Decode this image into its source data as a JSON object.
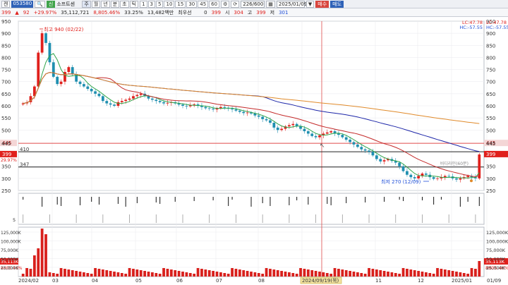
{
  "toolbar": {
    "menu_label": "켄",
    "code": "053580",
    "theme_tag": "신",
    "stock_name": "소프트센",
    "periods": [
      "주",
      "월",
      "년",
      "분",
      "초",
      "틱"
    ],
    "intervals": [
      "1",
      "3",
      "5",
      "10",
      "15",
      "30",
      "45",
      "60"
    ],
    "page_count": "226/600",
    "date": "2025/01/09",
    "buy_label": "매수",
    "sell_label": "매도"
  },
  "quote": {
    "price": "399",
    "change": "92",
    "change_pct": "+29.97%",
    "volume": "35,112,721",
    "vol_ratio": "8,805.46%",
    "turnover": "33.25%",
    "amount": "13,482백만",
    "priority_label": "최우선",
    "priority_value": "0",
    "o_value": "399",
    "h_label": "시",
    "h_value": "304",
    "hl_label": "고",
    "hl_value": "399",
    "low_label": "저",
    "low_value": "301"
  },
  "colors": {
    "up": "#e0201c",
    "down": "#1f8fb0",
    "ma_short": "#2fa44a",
    "ma_mid": "#c42a2a",
    "ma_long": "#1c25a8",
    "ma_longest": "#e08a2a",
    "volume": "#d8201c"
  },
  "chart_data": {
    "type": "candlestick",
    "price_axis": {
      "min": 250,
      "max": 950,
      "ticks": [
        "950",
        "900",
        "850",
        "800",
        "750",
        "700",
        "650",
        "600",
        "550",
        "500",
        "445",
        "350",
        "300",
        "250"
      ]
    },
    "volume_axis_ticks": [
      "125,000K",
      "100,000K",
      "75,000K",
      "50,000K",
      "25,000K"
    ],
    "x_labels": [
      "2024/02",
      "03",
      "04",
      "05",
      "06",
      "07",
      "08",
      "2024/09/19(목)",
      "11",
      "12",
      "2025/01",
      "01/09"
    ],
    "annotations": {
      "high": "최고 940 (02/22)",
      "low": "최저 270 (12/09)",
      "lc": "LC:47.78",
      "hc": "HC:-57.55",
      "level_445": "445",
      "level_410": "410",
      "level_347": "347",
      "last_price": "399",
      "last_change": "29.97%",
      "last_volume": "35,113K",
      "last_vol_ratio": "8805.46%",
      "faded_label": "바디라인(60분)",
      "sub_tick": "5"
    },
    "close": [
      610,
      615,
      640,
      680,
      820,
      900,
      860,
      780,
      720,
      690,
      700,
      740,
      760,
      730,
      700,
      690,
      680,
      670,
      660,
      650,
      640,
      620,
      610,
      605,
      600,
      615,
      620,
      625,
      630,
      640,
      645,
      650,
      640,
      630,
      625,
      620,
      615,
      610,
      612,
      615,
      610,
      605,
      600,
      598,
      602,
      606,
      600,
      595,
      590,
      588,
      585,
      590,
      595,
      592,
      588,
      585,
      580,
      575,
      570,
      572,
      568,
      560,
      555,
      545,
      540,
      530,
      510,
      500,
      505,
      515,
      520,
      525,
      515,
      505,
      495,
      485,
      475,
      470,
      478,
      485,
      490,
      495,
      485,
      480,
      470,
      460,
      450,
      440,
      430,
      420,
      415,
      410,
      395,
      380,
      370,
      375,
      380,
      372,
      365,
      350,
      330,
      315,
      305,
      300,
      310,
      320,
      315,
      305,
      298,
      300,
      305,
      310,
      308,
      300,
      295,
      300,
      305,
      310,
      305,
      300,
      399
    ]
  }
}
